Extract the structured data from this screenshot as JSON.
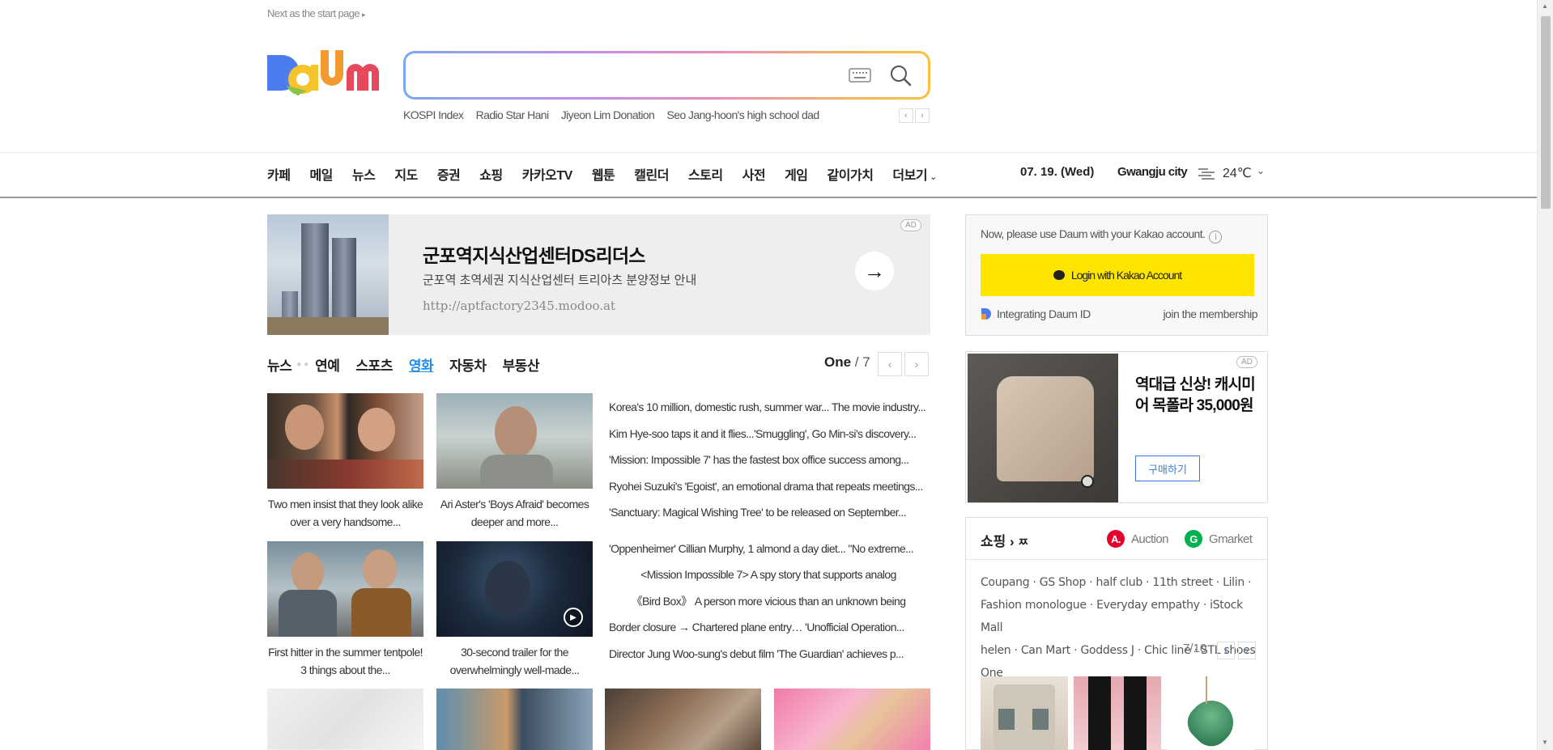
{
  "top": {
    "start_page": "Next as the start page"
  },
  "search": {
    "placeholder": "",
    "trends": [
      "KOSPI Index",
      "Radio Star Hani",
      "Jiyeon Lim Donation",
      "Seo Jang-hoon's high school dad"
    ],
    "trend_prev": "‹",
    "trend_next": "›"
  },
  "nav": {
    "items": [
      "카페",
      "메일",
      "뉴스",
      "지도",
      "증권",
      "쇼핑",
      "카카오TV",
      "웹툰",
      "캘린더",
      "스토리",
      "사전",
      "게임",
      "같이가치",
      "더보기"
    ],
    "more_chevron": "⌄",
    "date": "07. 19. (Wed)",
    "city": "Gwangju city",
    "temp": "24℃",
    "weather_icon": "haze-icon"
  },
  "ad_banner": {
    "badge": "AD",
    "title": "군포역지식산업센터DS리더스",
    "subtitle": "군포역 초역세권 지식산업센터 트리아츠 분양정보 안내",
    "url": "http://aptfactory2345.modoo.at",
    "arrow": "→"
  },
  "news": {
    "tabs": [
      "뉴스",
      "연예",
      "스포츠",
      "영화",
      "자동차",
      "부동산"
    ],
    "active_tab": "영화",
    "page_current": "One",
    "page_total": "/ 7",
    "cards": [
      {
        "caption": "Two men insist that they look alike over a very handsome..."
      },
      {
        "caption": "Ari Aster's 'Boys Afraid' becomes deeper and more..."
      },
      {
        "caption": "First hitter in the summer tentpole! 3 things about the..."
      },
      {
        "caption": "30-second trailer for the overwhelmingly well-made..."
      }
    ],
    "headlines": [
      "Korea's 10 million, domestic rush, summer war... The movie industry...",
      "Kim Hye-soo taps it and it flies...'Smuggling', Go Min-si's discovery...",
      "'Mission: Impossible 7' has the fastest box office success among...",
      "Ryohei Suzuki's 'Egoist', an emotional drama that repeats meetings...",
      "'Sanctuary: Magical Wishing Tree' to be released on September...",
      "'Oppenheimer' Cillian Murphy, 1 almond a day diet... \"No extreme...",
      "<Mission Impossible 7> A spy story that supports analog",
      "《Bird Box》 A person more vicious than an unknown being",
      "Border closure → Chartered plane entry… 'Unofficial Operation...",
      "Director Jung Woo-sung's debut film 'The Guardian' achieves p..."
    ]
  },
  "login": {
    "message": "Now, please use Daum with your Kakao account.",
    "info_icon": "i",
    "kakao_button": "Login with Kakao Account",
    "integrate": "Integrating Daum ID",
    "join": "join the membership"
  },
  "product_ad": {
    "badge": "AD",
    "title": "역대급 신상! 캐시미어 목폴라 35,000원",
    "button": "구매하기"
  },
  "shopping": {
    "title": "쇼핑",
    "title_glyph": "›",
    "title_extra": "ㅉ",
    "auction_logo": "A.",
    "auction": "Auction",
    "gmarket_logo": "G",
    "gmarket": "Gmarket",
    "links_line1": "Coupang · GS Shop · half club · 11th street · Lilin ·",
    "links_line2": "Fashion monologue · Everyday empathy · iStock Mall",
    "links_line3": "helen · Can Mart · Goddess J · Chic line · STL shoes",
    "links_line4": "One",
    "page": "7/10",
    "prev": "‹",
    "next": "›"
  },
  "colors": {
    "kakao_yellow": "#fee500",
    "active_tab": "#1e8cf0",
    "auction_red": "#e4002b",
    "gmarket_green": "#00b14f"
  }
}
